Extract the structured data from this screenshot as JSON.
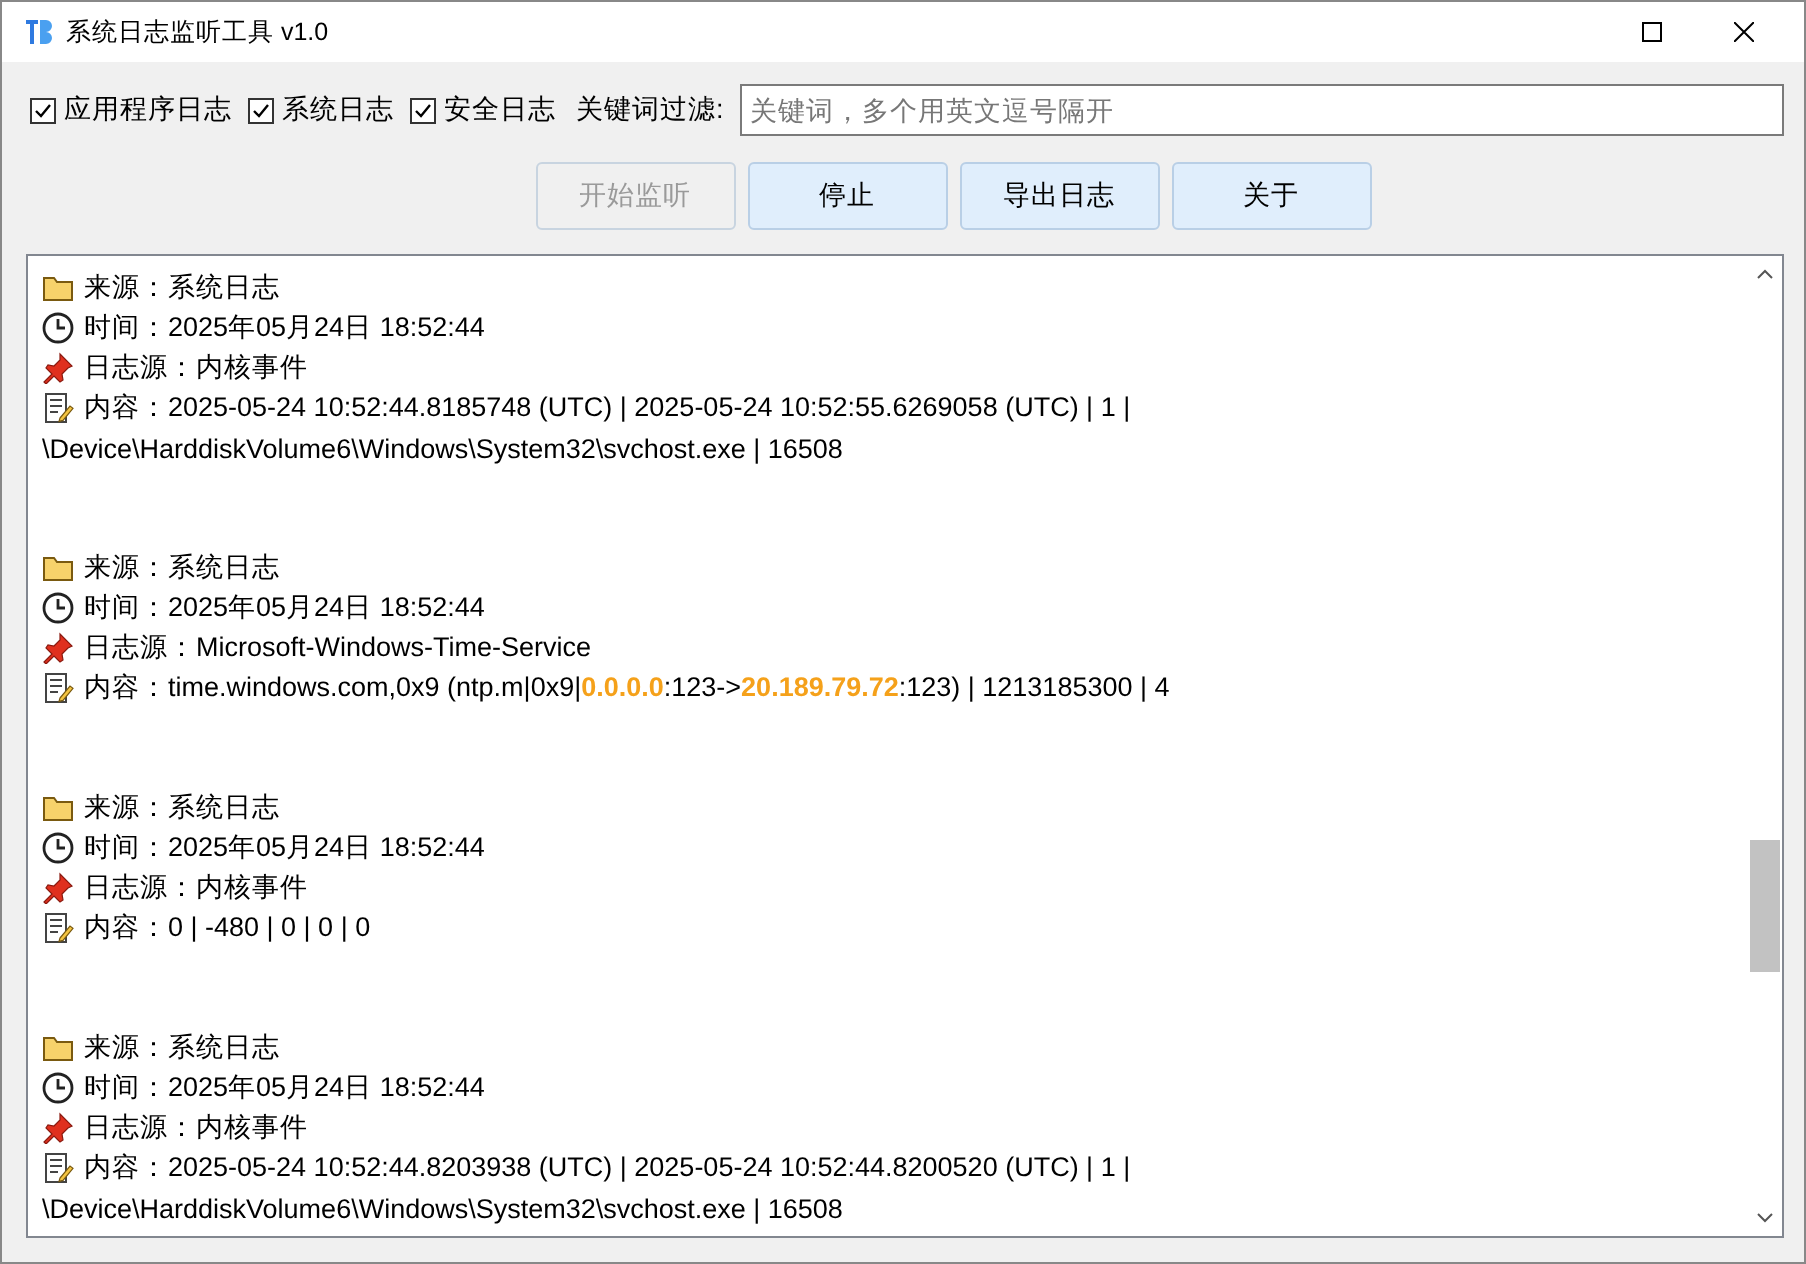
{
  "window": {
    "title": "系统日志监听工具 v1.0"
  },
  "filters": [
    {
      "label": "应用程序日志",
      "checked": true
    },
    {
      "label": "系统日志",
      "checked": true
    },
    {
      "label": "安全日志",
      "checked": true
    }
  ],
  "keyword": {
    "label": "关键词过滤:",
    "placeholder": "关键词，多个用英文逗号隔开"
  },
  "buttons": [
    {
      "label": "开始监听",
      "disabled": true
    },
    {
      "label": "停止",
      "disabled": false
    },
    {
      "label": "导出日志",
      "disabled": false
    },
    {
      "label": "关于",
      "disabled": false
    }
  ],
  "entries": [
    {
      "source": "来源：系统日志",
      "time": "时间：2025年05月24日 18:52:44",
      "provider": "日志源：内核事件",
      "content": [
        [
          {
            "text": "内容：2025-05-24 10:52:44.8185748 (UTC) | 2025-05-24 10:52:55.6269058 (UTC) | 1 |",
            "highlight": false
          }
        ],
        [
          {
            "text": "\\Device\\HarddiskVolume6\\Windows\\System32\\svchost.exe | 16508",
            "highlight": false
          }
        ]
      ]
    },
    {
      "source": "来源：系统日志",
      "time": "时间：2025年05月24日 18:52:44",
      "provider": "日志源：Microsoft-Windows-Time-Service",
      "content": [
        [
          {
            "text": "内容：time.windows.com,0x9 (ntp.m|0x9|",
            "highlight": false
          },
          {
            "text": "0.0.0.0",
            "highlight": true
          },
          {
            "text": ":123->",
            "highlight": false
          },
          {
            "text": "20.189.79.72",
            "highlight": true
          },
          {
            "text": ":123) | 1213185300 | 4",
            "highlight": false
          }
        ]
      ]
    },
    {
      "source": "来源：系统日志",
      "time": "时间：2025年05月24日 18:52:44",
      "provider": "日志源：内核事件",
      "content": [
        [
          {
            "text": "内容：0 | -480 | 0 | 0 | 0",
            "highlight": false
          }
        ]
      ]
    },
    {
      "source": "来源：系统日志",
      "time": "时间：2025年05月24日 18:52:44",
      "provider": "日志源：内核事件",
      "content": [
        [
          {
            "text": "内容：2025-05-24 10:52:44.8203938 (UTC) | 2025-05-24 10:52:44.8200520 (UTC) | 1 |",
            "highlight": false
          }
        ],
        [
          {
            "text": "\\Device\\HarddiskVolume6\\Windows\\System32\\svchost.exe | 16508",
            "highlight": false
          }
        ]
      ]
    }
  ]
}
